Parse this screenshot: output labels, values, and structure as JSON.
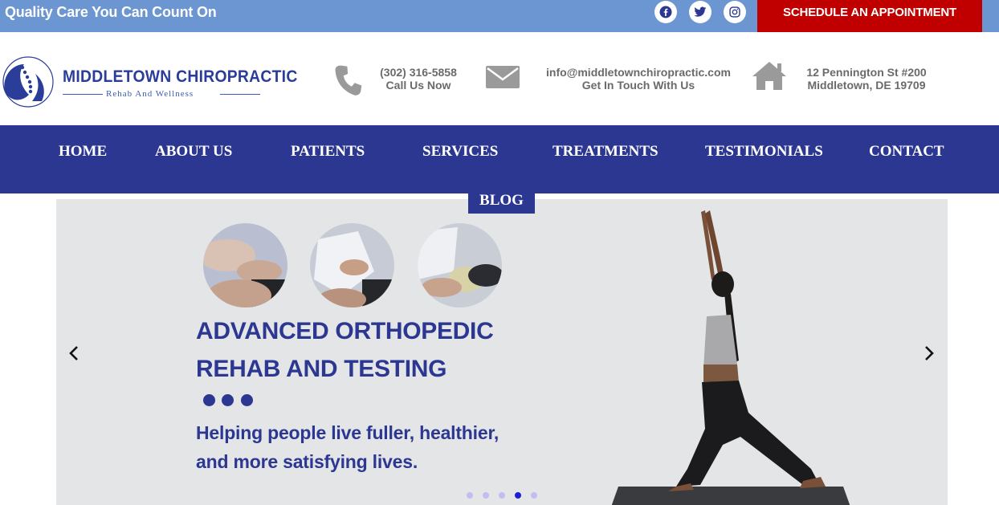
{
  "topbar": {
    "tagline": "Quality Care You Can Count On",
    "social": [
      {
        "name": "facebook-icon"
      },
      {
        "name": "twitter-icon"
      },
      {
        "name": "instagram-icon"
      }
    ],
    "schedule_label": "SCHEDULE AN APPOINTMENT"
  },
  "logo": {
    "title": "MIDDLETOWN CHIROPRACTIC",
    "subtitle": "Rehab And Wellness"
  },
  "contacts": {
    "phone": {
      "line1": "(302) 316-5858",
      "line2": "Call Us Now",
      "icon": "phone-icon"
    },
    "email": {
      "line1": "info@middletownchiropractic.com",
      "line2": "Get In Touch With Us",
      "icon": "envelope-icon"
    },
    "address": {
      "line1": "12 Pennington St #200",
      "line2": "Middletown, DE 19709",
      "icon": "home-icon"
    }
  },
  "nav": {
    "items": [
      {
        "label": "HOME"
      },
      {
        "label": "ABOUT US"
      },
      {
        "label": "PATIENTS"
      },
      {
        "label": "SERVICES"
      },
      {
        "label": "TREATMENTS"
      },
      {
        "label": "TESTIMONIALS"
      },
      {
        "label": "CONTACT"
      },
      {
        "label": "BLOG"
      }
    ]
  },
  "slider": {
    "headline_line1": "ADVANCED ORTHOPEDIC",
    "headline_line2": "REHAB AND TESTING",
    "body_line1": "Helping people live fuller, healthier,",
    "body_line2": "and more satisfying lives.",
    "total_slides": 5,
    "active_slide": 4
  },
  "colors": {
    "topbar": "#6b96d1",
    "schedule": "#c00000",
    "nav": "#2c3791",
    "accent_text": "#2c3791",
    "slider_bg": "#e4e5e7"
  }
}
